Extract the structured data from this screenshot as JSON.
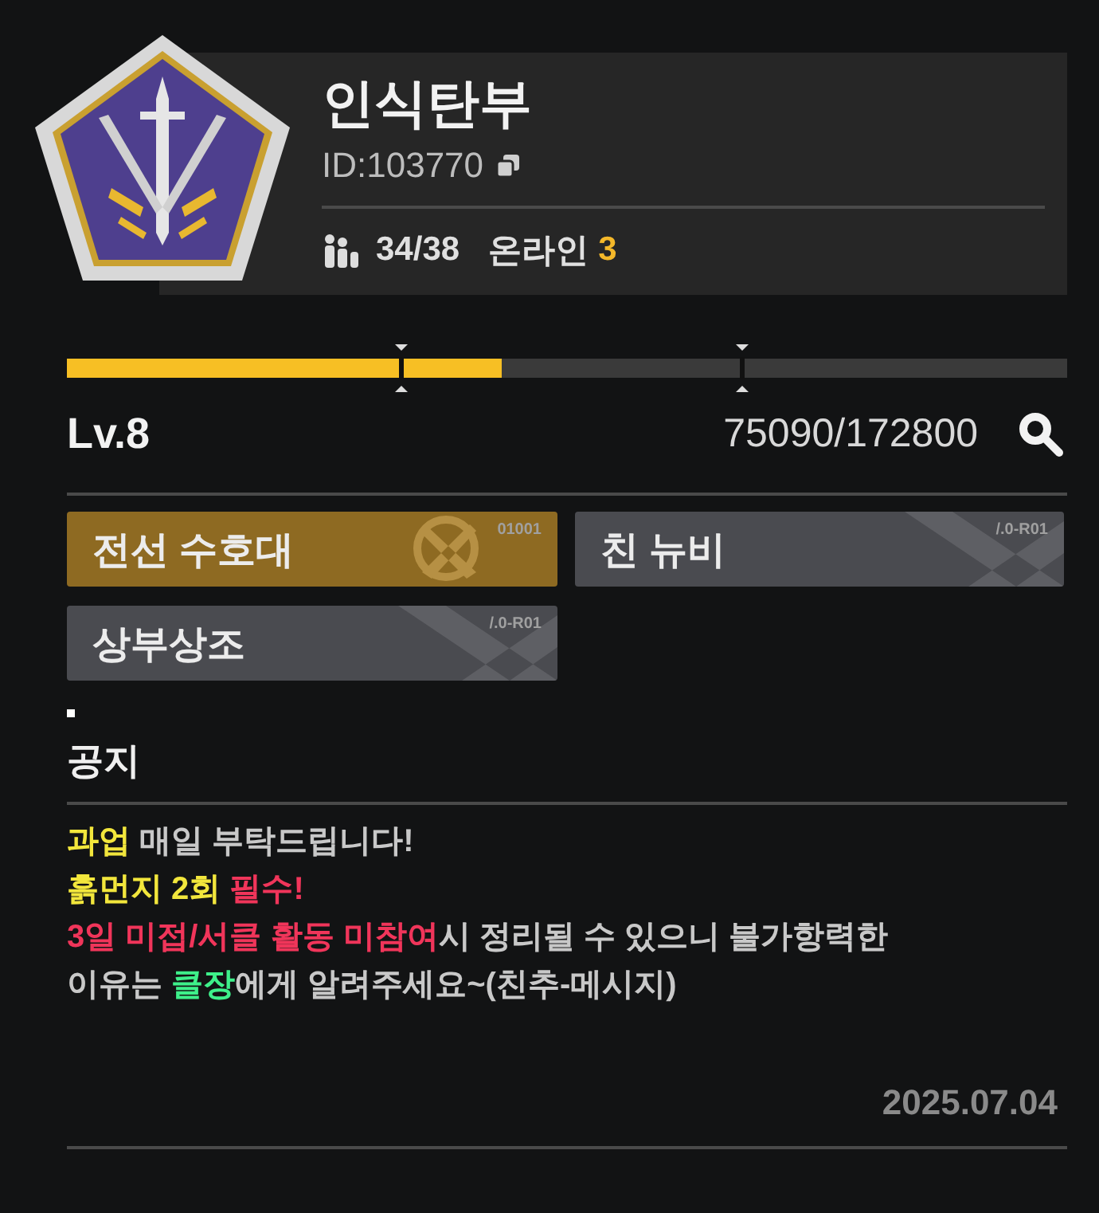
{
  "guild": {
    "name": "인식탄부",
    "id": "ID:103770",
    "members": "34/38",
    "online_label": "온라인",
    "online_count": "3"
  },
  "progress": {
    "level_label": "Lv.8",
    "level": 0.434,
    "reading": "75090/172800"
  },
  "titles": [
    {
      "label": "전선 수호대",
      "code": "01001",
      "selected": true
    },
    {
      "label": "친 뉴비",
      "code": "/.0-R01",
      "selected": false
    },
    {
      "label": "상부상조",
      "code": "/.0-R01",
      "selected": false
    }
  ],
  "notice": {
    "heading": "공지",
    "lines": [
      [
        {
          "text": "과업",
          "color": "#f2e63c"
        },
        {
          "text": " 매일 부탁드립니다!",
          "color": "#c8c8c8"
        }
      ],
      [
        {
          "text": "흙먼지 2회",
          "color": "#f2e63c"
        },
        {
          "text": " 필수!",
          "color": "#f0355a"
        }
      ],
      [
        {
          "text": "3일 미접/서클 활동 미참여",
          "color": "#f0355a"
        },
        {
          "text": "시 정리될 수 있으니 불가항력한",
          "color": "#c8c8c8"
        }
      ],
      [
        {
          "text": "이유는 ",
          "color": "#c8c8c8"
        },
        {
          "text": "클장",
          "color": "#3ef08a"
        },
        {
          "text": "에게 알려주세요~(친추-메시지)",
          "color": "#c8c8c8"
        }
      ]
    ],
    "date": "2025.07.04"
  }
}
